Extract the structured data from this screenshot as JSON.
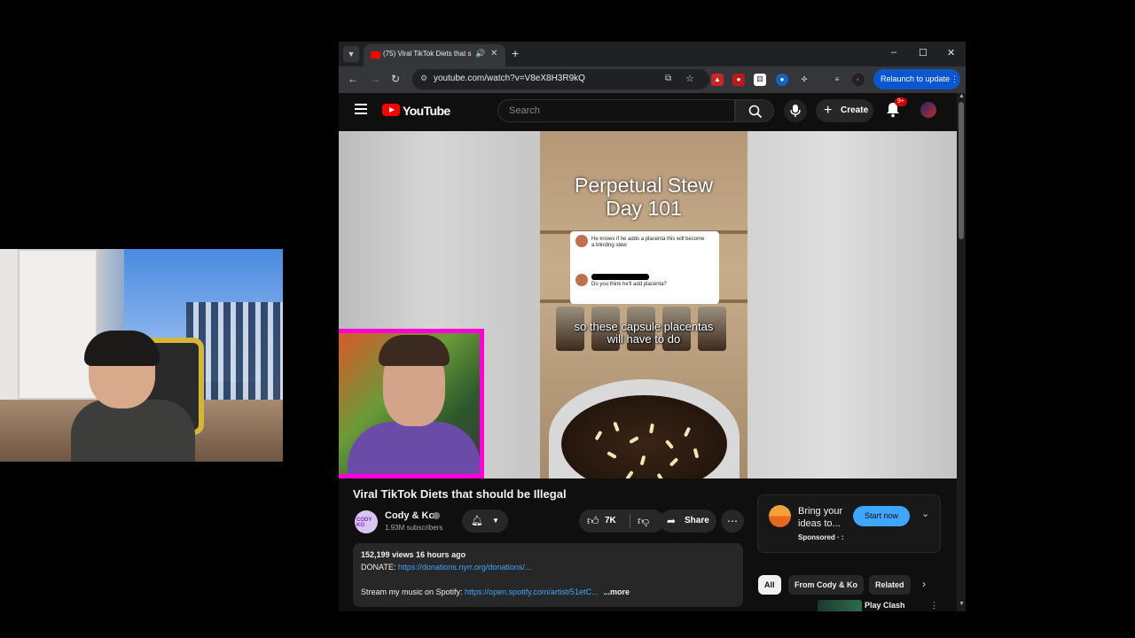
{
  "browser": {
    "tab_title": "(75) Viral TikTok Diets that s",
    "audio_icon": "speaker-icon",
    "url": "youtube.com/watch?v=V8eX8H3R9kQ",
    "relaunch_label": "Relaunch to update",
    "window_controls": {
      "minimize": "–",
      "maximize": "☐",
      "close": "✕"
    },
    "nav": {
      "back": "←",
      "forward": "→",
      "reload": "↻"
    }
  },
  "youtube": {
    "logo_text": "YouTube",
    "search_placeholder": "Search",
    "create_label": "Create",
    "notification_badge": "9+",
    "video": {
      "overlay_title_line1": "Perpetual Stew",
      "overlay_title_line2": "Day 101",
      "comment1": "He knows if he adds a placenta this will become a blinding stew",
      "comment2": "Do you think he'll add placenta?",
      "caption_line1": "so these capsule placentas",
      "caption_line2": "will have to do"
    },
    "title": "Viral TikTok Diets that should be Illegal",
    "channel": {
      "name": "Cody & Ko",
      "subscribers": "1.93M subscribers"
    },
    "like_count": "7K",
    "share_label": "Share",
    "description": {
      "stats": "152,199 views  16 hours ago",
      "donate_label": "DONATE: ",
      "donate_link": "https://donations.nyrr.org/donations/...",
      "spotify_label": "Stream my music on Spotify: ",
      "spotify_link": "https://open.spotify.com/artist/51etC...",
      "more_label": "...more"
    },
    "ad": {
      "text": "Bring your ideas to...",
      "sponsored": "Sponsored · :",
      "cta": "Start now"
    },
    "chips": [
      "All",
      "From Cody & Ko",
      "Related"
    ],
    "recommendation": {
      "title": "Play Clash"
    }
  },
  "colors": {
    "youtube_red": "#ff0000",
    "accent_blue": "#3ea6ff",
    "relaunch_blue": "#0b57d0",
    "facecam_border": "#ff00d6"
  }
}
